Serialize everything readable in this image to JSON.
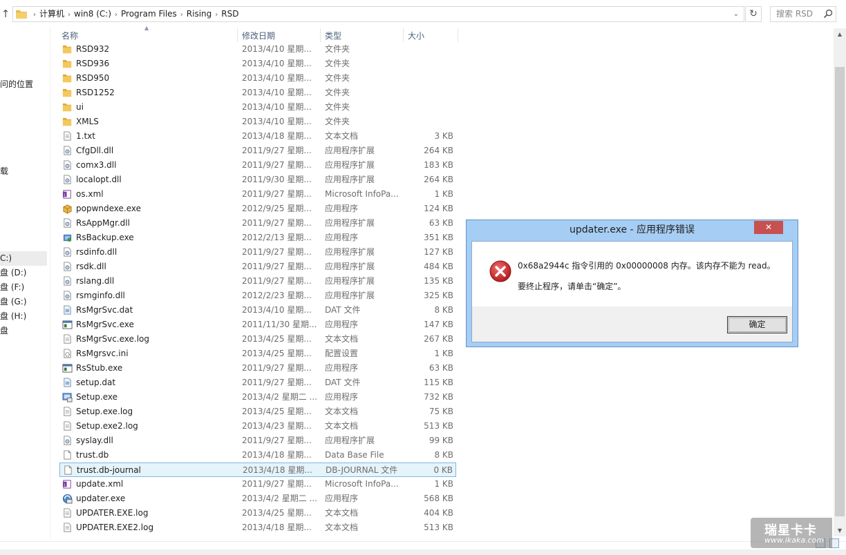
{
  "address": {
    "crumbs": [
      "计算机",
      "win8 (C:)",
      "Program Files",
      "Rising",
      "RSD"
    ],
    "search_placeholder": "搜索 RSD"
  },
  "nav": {
    "items": [
      "问的位置",
      "载",
      "C:)",
      "盘 (D:)",
      "盘 (F:)",
      "盘 (G:)",
      "盘 (H:)",
      "盘"
    ]
  },
  "columns": {
    "name": "名称",
    "date": "修改日期",
    "type": "类型",
    "size": "大小"
  },
  "files": [
    {
      "name": "RSD932",
      "date": "2013/4/10 星期...",
      "type": "文件夹",
      "size": "",
      "icon": "folder"
    },
    {
      "name": "RSD936",
      "date": "2013/4/10 星期...",
      "type": "文件夹",
      "size": "",
      "icon": "folder"
    },
    {
      "name": "RSD950",
      "date": "2013/4/10 星期...",
      "type": "文件夹",
      "size": "",
      "icon": "folder"
    },
    {
      "name": "RSD1252",
      "date": "2013/4/10 星期...",
      "type": "文件夹",
      "size": "",
      "icon": "folder"
    },
    {
      "name": "ui",
      "date": "2013/4/10 星期...",
      "type": "文件夹",
      "size": "",
      "icon": "folder"
    },
    {
      "name": "XMLS",
      "date": "2013/4/10 星期...",
      "type": "文件夹",
      "size": "",
      "icon": "folder"
    },
    {
      "name": "1.txt",
      "date": "2013/4/18 星期...",
      "type": "文本文档",
      "size": "3 KB",
      "icon": "text"
    },
    {
      "name": "CfgDll.dll",
      "date": "2011/9/27 星期...",
      "type": "应用程序扩展",
      "size": "264 KB",
      "icon": "dll"
    },
    {
      "name": "comx3.dll",
      "date": "2011/9/27 星期...",
      "type": "应用程序扩展",
      "size": "183 KB",
      "icon": "dll"
    },
    {
      "name": "localopt.dll",
      "date": "2011/9/30 星期...",
      "type": "应用程序扩展",
      "size": "264 KB",
      "icon": "dll"
    },
    {
      "name": "os.xml",
      "date": "2011/9/27 星期...",
      "type": "Microsoft InfoPa...",
      "size": "1 KB",
      "icon": "infopath"
    },
    {
      "name": "popwndexe.exe",
      "date": "2012/9/25 星期...",
      "type": "应用程序",
      "size": "124 KB",
      "icon": "package"
    },
    {
      "name": "RsAppMgr.dll",
      "date": "2011/9/27 星期...",
      "type": "应用程序扩展",
      "size": "63 KB",
      "icon": "dll"
    },
    {
      "name": "RsBackup.exe",
      "date": "2012/2/13 星期...",
      "type": "应用程序",
      "size": "351 KB",
      "icon": "backup"
    },
    {
      "name": "rsdinfo.dll",
      "date": "2011/9/27 星期...",
      "type": "应用程序扩展",
      "size": "127 KB",
      "icon": "dll"
    },
    {
      "name": "rsdk.dll",
      "date": "2011/9/27 星期...",
      "type": "应用程序扩展",
      "size": "484 KB",
      "icon": "dll"
    },
    {
      "name": "rslang.dll",
      "date": "2011/9/27 星期...",
      "type": "应用程序扩展",
      "size": "135 KB",
      "icon": "dll"
    },
    {
      "name": "rsmginfo.dll",
      "date": "2012/2/23 星期...",
      "type": "应用程序扩展",
      "size": "325 KB",
      "icon": "dll"
    },
    {
      "name": "RsMgrSvc.dat",
      "date": "2013/4/10 星期...",
      "type": "DAT 文件",
      "size": "8 KB",
      "icon": "dat"
    },
    {
      "name": "RsMgrSvc.exe",
      "date": "2011/11/30 星期...",
      "type": "应用程序",
      "size": "147 KB",
      "icon": "exe"
    },
    {
      "name": "RsMgrSvc.exe.log",
      "date": "2013/4/25 星期...",
      "type": "文本文档",
      "size": "267 KB",
      "icon": "text"
    },
    {
      "name": "RsMgrsvc.ini",
      "date": "2013/4/25 星期...",
      "type": "配置设置",
      "size": "1 KB",
      "icon": "ini"
    },
    {
      "name": "RsStub.exe",
      "date": "2011/9/27 星期...",
      "type": "应用程序",
      "size": "63 KB",
      "icon": "exe"
    },
    {
      "name": "setup.dat",
      "date": "2011/9/27 星期...",
      "type": "DAT 文件",
      "size": "115 KB",
      "icon": "dat"
    },
    {
      "name": "Setup.exe",
      "date": "2013/4/2 星期二 ...",
      "type": "应用程序",
      "size": "732 KB",
      "icon": "setup"
    },
    {
      "name": "Setup.exe.log",
      "date": "2013/4/25 星期...",
      "type": "文本文档",
      "size": "75 KB",
      "icon": "text"
    },
    {
      "name": "Setup.exe2.log",
      "date": "2013/4/23 星期...",
      "type": "文本文档",
      "size": "513 KB",
      "icon": "text"
    },
    {
      "name": "syslay.dll",
      "date": "2011/9/27 星期...",
      "type": "应用程序扩展",
      "size": "99 KB",
      "icon": "dll"
    },
    {
      "name": "trust.db",
      "date": "2013/4/18 星期...",
      "type": "Data Base File",
      "size": "8 KB",
      "icon": "blank"
    },
    {
      "name": "trust.db-journal",
      "date": "2013/4/18 星期...",
      "type": "DB-JOURNAL 文件",
      "size": "0 KB",
      "icon": "blank",
      "selected": true
    },
    {
      "name": "update.xml",
      "date": "2011/9/27 星期...",
      "type": "Microsoft InfoPa...",
      "size": "1 KB",
      "icon": "infopath"
    },
    {
      "name": "updater.exe",
      "date": "2013/4/2 星期二 ...",
      "type": "应用程序",
      "size": "568 KB",
      "icon": "updater"
    },
    {
      "name": "UPDATER.EXE.log",
      "date": "2013/4/25 星期...",
      "type": "文本文档",
      "size": "404 KB",
      "icon": "text"
    },
    {
      "name": "UPDATER.EXE2.log",
      "date": "2013/4/18 星期...",
      "type": "文本文档",
      "size": "513 KB",
      "icon": "text"
    }
  ],
  "dialog": {
    "title": "updater.exe - 应用程序错误",
    "close_label": "✕",
    "message_line1": "0x68a2944c 指令引用的 0x00000008 内存。该内存不能为 read。",
    "message_line2": "要终止程序，请单击“确定”。",
    "ok_label": "确定"
  },
  "watermark": {
    "line1": "瑞星卡卡",
    "line2": "www.ikaka.com"
  },
  "colors": {
    "dialog_frame": "#a6cdf3",
    "close_button": "#c75050",
    "selection_bg": "#e5f3fb",
    "selection_border": "#7ab8e0",
    "folder": "#e8b84a",
    "error_red": "#d8282c"
  }
}
